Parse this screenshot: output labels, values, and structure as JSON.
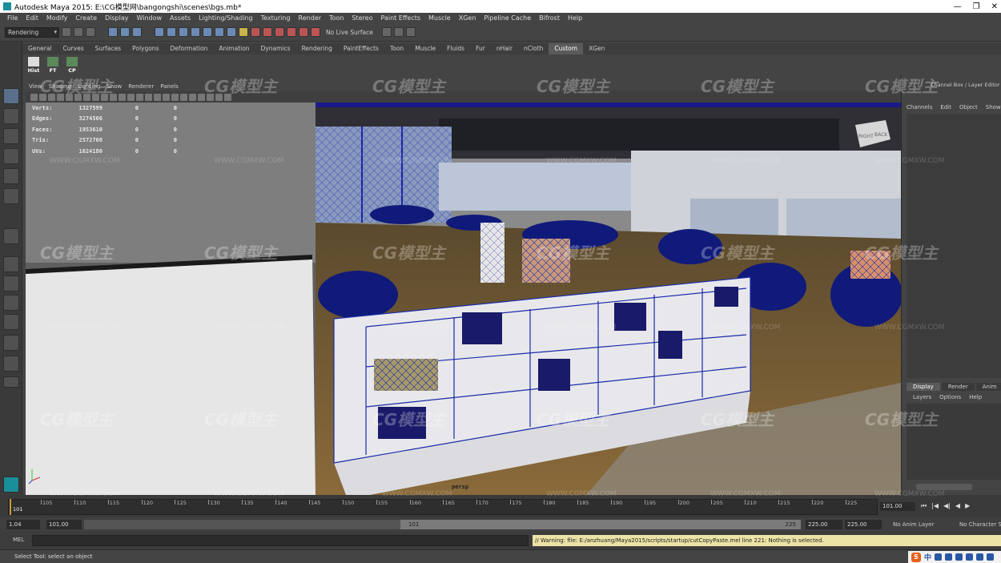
{
  "window": {
    "title": "Autodesk Maya 2015: E:\\CG模型网\\bangongshi\\scenes\\bgs.mb*",
    "minimize": "—",
    "maximize": "❐",
    "close": "✕"
  },
  "menu": [
    "File",
    "Edit",
    "Modify",
    "Create",
    "Display",
    "Window",
    "Assets",
    "Lighting/Shading",
    "Texturing",
    "Render",
    "Toon",
    "Stereo",
    "Paint Effects",
    "Muscle",
    "XGen",
    "Pipeline Cache",
    "Bifrost",
    "Help"
  ],
  "status_line": {
    "mode": "Rendering",
    "live_surface": "No Live Surface"
  },
  "shelf_tabs": [
    "General",
    "Curves",
    "Surfaces",
    "Polygons",
    "Deformation",
    "Animation",
    "Dynamics",
    "Rendering",
    "PaintEffects",
    "Toon",
    "Muscle",
    "Fluids",
    "Fur",
    "nHair",
    "nCloth",
    "Custom",
    "XGen"
  ],
  "shelf_active_tab": "Custom",
  "shelf_buttons": [
    "Hist",
    "FT",
    "CP"
  ],
  "viewport_menu": [
    "View",
    "Shading",
    "Lighting",
    "Show",
    "Renderer",
    "Panels"
  ],
  "hud": {
    "rows": [
      {
        "label": "Verts:",
        "a": "1327599",
        "b": "0",
        "c": "0"
      },
      {
        "label": "Edges:",
        "a": "3274566",
        "b": "0",
        "c": "0"
      },
      {
        "label": "Faces:",
        "a": "1953610",
        "b": "0",
        "c": "0"
      },
      {
        "label": "Tris:",
        "a": "2572708",
        "b": "0",
        "c": "0"
      },
      {
        "label": "UVs:",
        "a": "1624180",
        "b": "0",
        "c": "0"
      }
    ]
  },
  "camera_label": "persp",
  "view_cube": {
    "right": "RIGHT",
    "back": "BACK"
  },
  "right_panel": {
    "title": "Channel Box / Layer Editor",
    "menu": [
      "Channels",
      "Edit",
      "Object",
      "Show"
    ],
    "tabs": [
      "Display",
      "Render",
      "Anim"
    ],
    "active_tab": "Display",
    "sub_menu": [
      "Layers",
      "Options",
      "Help"
    ]
  },
  "timeline": {
    "ticks": [
      "105",
      "110",
      "115",
      "120",
      "125",
      "130",
      "135",
      "140",
      "145",
      "150",
      "155",
      "160",
      "165",
      "170",
      "175",
      "180",
      "185",
      "190",
      "195",
      "200",
      "205",
      "210",
      "215",
      "220",
      "225"
    ],
    "current": "101",
    "current_field": "101.00",
    "play_buttons": [
      "⏮",
      "|◀",
      "◀|",
      "◀",
      "▶"
    ]
  },
  "range": {
    "start_small": "1.04",
    "start": "101.00",
    "handle_start": "101",
    "handle_end": "225",
    "end": "225.00",
    "end2": "225.00",
    "anim_layer": "No Anim Layer",
    "char_set": "No Character Set"
  },
  "command_line": {
    "label": "MEL",
    "warning": "// Warning: file: E:/anzhuang/Maya2015/scripts/startup/cutCopyPaste.mel line 221: Nothing is selected."
  },
  "help_line": "Select Tool: select an object",
  "tray": {
    "ime": "S",
    "lang": "中"
  },
  "watermark": {
    "brand": "CG模型主",
    "site": "WWW.CGMXW.COM"
  }
}
